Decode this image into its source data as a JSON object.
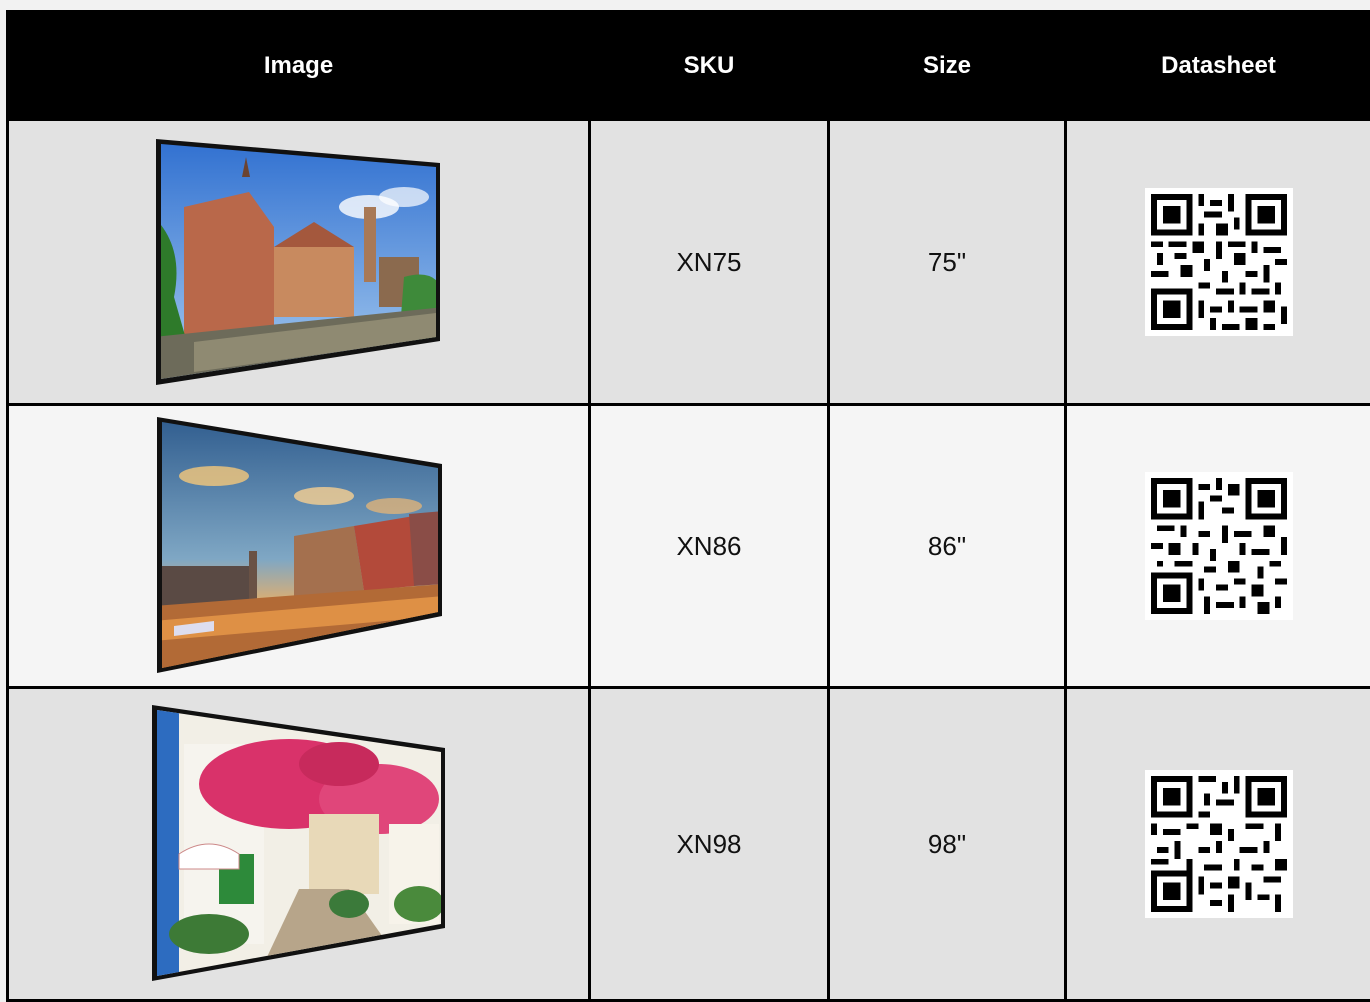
{
  "table": {
    "headers": {
      "image": "Image",
      "sku": "SKU",
      "size": "Size",
      "datasheet": "Datasheet"
    },
    "rows": [
      {
        "sku": "XN75",
        "size": "75\"",
        "image_subject": "canal-town-scene",
        "qr_icon": "qr-code-icon"
      },
      {
        "sku": "XN86",
        "size": "86\"",
        "image_subject": "city-sunset-waterfront",
        "qr_icon": "qr-code-icon"
      },
      {
        "sku": "XN98",
        "size": "98\"",
        "image_subject": "flowered-street",
        "qr_icon": "qr-code-icon"
      }
    ]
  },
  "colors": {
    "header_bg": "#000000",
    "header_text": "#ffffff",
    "row_alt_dark": "#e2e2e2",
    "row_alt_light": "#f5f5f5",
    "grid_lines": "#000000"
  }
}
